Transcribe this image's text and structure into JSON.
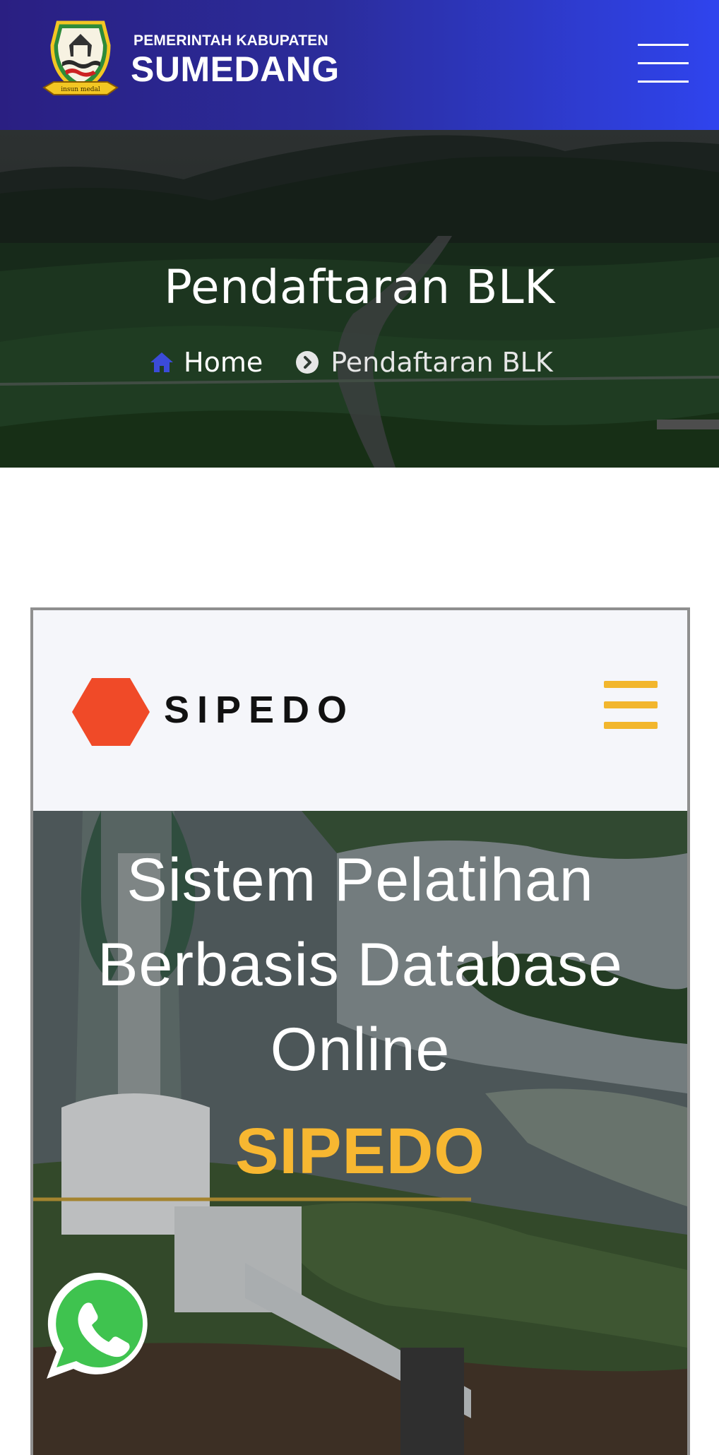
{
  "header": {
    "title_line1": "PEMERINTAH KABUPATEN",
    "title_line2": "SUMEDANG",
    "emblem_motto": "insun medal",
    "menu_icon": "hamburger-icon",
    "colors": {
      "gradient_start": "#2a1f82",
      "gradient_end": "#2f44ee"
    }
  },
  "page_hero": {
    "title": "Pendaftaran BLK",
    "breadcrumb": {
      "home_label": "Home",
      "home_icon": "home-icon",
      "separator_icon": "chevron-circle-right-icon",
      "current_label": "Pendaftaran BLK"
    },
    "colors": {
      "home_icon": "#3b4bd8"
    }
  },
  "embed": {
    "brand": "SIPEDO",
    "logo_icon": "hexagon-logo-icon",
    "menu_icon": "hamburger-icon",
    "hero_title": "Sistem Pelatihan Berbasis Database Online",
    "hero_highlight": "SIPEDO",
    "colors": {
      "hexagon": "#f04a28",
      "accent": "#f7b731",
      "menu": "#f2b62d"
    }
  },
  "floating": {
    "whatsapp_icon": "whatsapp-icon",
    "colors": {
      "whatsapp": "#3fc34f"
    }
  }
}
